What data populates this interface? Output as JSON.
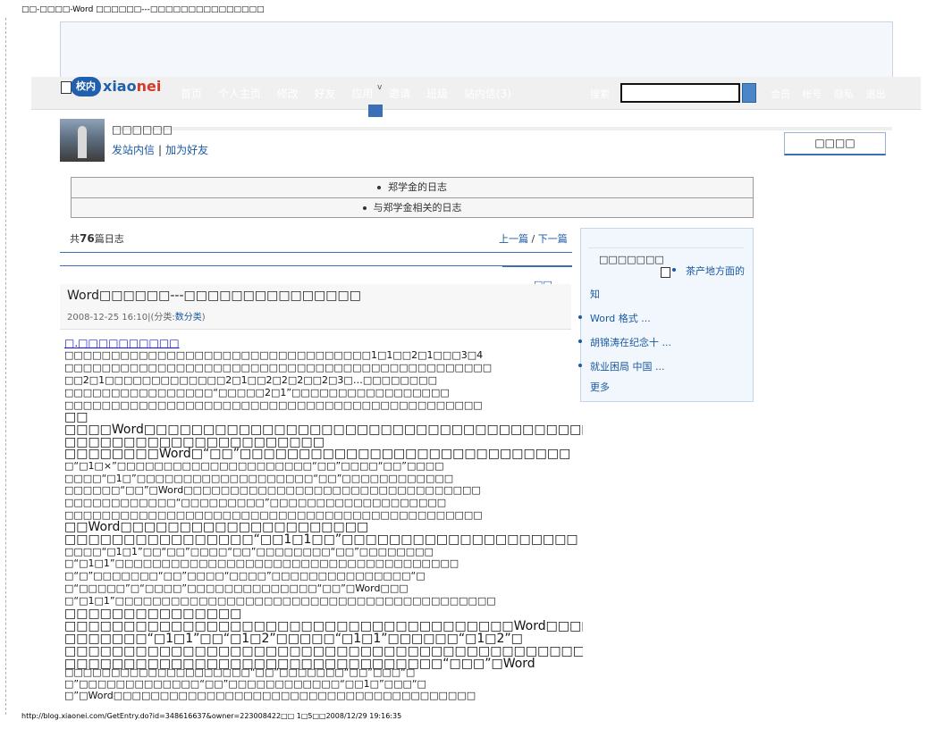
{
  "page_header": "□□-□□□□-Word □□□□□□---□□□□□□□□□□□□□□□",
  "page_footer": "http://blog.xiaonei.com/GetEntry.do?id=348616637&owner=223008422□□ 1□5□□2008/12/29 19:16:35",
  "logo": {
    "badge": "校内",
    "word_a": "xiao",
    "word_b": "nei",
    "square": "□"
  },
  "nav": {
    "items": [
      "首页",
      "个人主页",
      "修改",
      "好友",
      "应用",
      "邀请",
      "班级",
      "站内信(3)"
    ],
    "arrow": "v"
  },
  "search": {
    "label": "搜索",
    "value": ""
  },
  "user_links": [
    "会员",
    "帐号",
    "隐私",
    "退出"
  ],
  "profile": {
    "name": "□□□□□□",
    "send_msg": "发站内信",
    "add_friend": "加为好友",
    "separator": "|"
  },
  "right_tab": "□□□□",
  "tabs": [
    "郑学金的日志",
    "与郑学金相关的日志"
  ],
  "count": {
    "prefix": "共",
    "number": "76",
    "suffix": "篇日志"
  },
  "prevnext": {
    "prev": "上一篇",
    "sep": "/",
    "next": "下一篇"
  },
  "sidebar_link": "□□",
  "post": {
    "title": "Word□□□□□□---□□□□□□□□□□□□□□□",
    "datetime": "2008-12-25 16:10",
    "meta_sep": "|(",
    "category_label": "分类:",
    "category": "数分类",
    "meta_close": ")"
  },
  "body_lines": [
    {
      "text": "□.□□□□□□□□□□",
      "style": "link"
    },
    {
      "text": "□□□□□□□□□□□□□□□□□□□□□□□□□□□□□□□□□1□1□□2□1□□□3□4",
      "style": ""
    },
    {
      "text": "□□□□□□□□□□□□□□□□□□□□□□□□□□□□□□□□□□□□□□□□□□□□□□",
      "style": ""
    },
    {
      "text": "□□2□1□□□□□□□□□□□□□2□1□□2□2□2□□2□3□…□□□□□□□□",
      "style": ""
    },
    {
      "text": "□□□□□□□□□□□□□□□□“□□□□□2□1”□□□□□□□□□□□□□□□□□",
      "style": ""
    },
    {
      "text": "□□□□□□□□□□□□□□□□□□□□□□□□□□□□□□□□□□□□□□□□□□□□□",
      "style": ""
    },
    {
      "text": "□□",
      "style": "big"
    },
    {
      "text": "  □□□□Word□□□□□□□□□□□□□□□□□□□□□□□□□□□□□□□□□□□□□□",
      "style": "big"
    },
    {
      "text": "□□□□□□□□□□□□□□□□□□□□□□",
      "style": "big"
    },
    {
      "text": "  □□□□□□□□Word□“□□”□□□□□□□□□□□□□□□□□□□□□□□□□□□□",
      "style": "big"
    },
    {
      "text": "□“□1□×”□□□□□□□□□□□□□□□□□□□□□“□□”□□□□“□□”□□□□",
      "style": ""
    },
    {
      "text": "□□□□“□1□”□□□□□□□□□□□□□□□□□□□“□□”□□□□□□□□□□□□",
      "style": ""
    },
    {
      "text": "□□□□□□“□□”□Word□□□□□□□□□□□□□□□□□□□□□□□□□□□□□□□□",
      "style": ""
    },
    {
      "text": "□□□□□□□□□□□□“□□□□□□□□□”□□□□□□□□□□□□□□□□□□□",
      "style": ""
    },
    {
      "text": "□□□□□□□□□□□□□□□□□□□□□□□□□□□□□□□□□□□□□□□□□□□□□",
      "style": ""
    },
    {
      "text": "□□Word□□□□□□□□□□□□□□□□□□□□□",
      "style": "big"
    },
    {
      "text": "  □□□□□□□□□□□□□□□□“□□1□1□□”□□□□□□□□□□□□□□□□□□□□",
      "style": "big"
    },
    {
      "text": "□□□□“□1□1”□□“□□”□□□□“□□”□□□□□□□□“□□”□□□□□□□□",
      "style": ""
    },
    {
      "text": "□“□1□1”□□□□□□□□□□□□□□□□□□□□□□□□□□□□□□□□□□□□□",
      "style": ""
    },
    {
      "text": "□“□”□□□□□□□“□□”□□□□“□□□□”□□□□□□□□□□□□□□□“□",
      "style": ""
    },
    {
      "text": "□“□□□□□”□“□□□□”□□□□□□□□□□□□□□“□□”□Word□□□",
      "style": ""
    },
    {
      "text": "□“□1□1”□□□□□□□□□□□□□□□□□□□□□□□□□□□□□□□□□□□□□□□□□",
      "style": ""
    },
    {
      "text": "□□□□□□□□□□□□□□□",
      "style": "big"
    },
    {
      "text": "  □□□□□□□□□□□□□□□□□□□□□□□□□□□□□□□□□□□□□□Word□□□□",
      "style": "big"
    },
    {
      "text": "□□□□□□□“□1□1”□□“□1□2”□□□□□“□1□1”□□□□□□“□1□2”□",
      "style": "big"
    },
    {
      "text": "  □□□□□□□□□□□□□□□□□□□□□□□□□□□□□□□□□□□□□□□□□□□□",
      "style": "big"
    },
    {
      "text": "  □□□□□□□□□□□□□□□□□□□□□□□□□□□□□□□□“□□□”□Word",
      "style": "big"
    },
    {
      "text": "□□□□□□□□□□□□□□□□□□□□“□□”□□□□□□□“□□”□□□“□",
      "style": ""
    },
    {
      "text": "□”□□□□□□□□□□□□□“□□”□□□□□□□□□□□□“□□1□”□□□“□",
      "style": ""
    },
    {
      "text": "□”□Word□□□□□□□□□□□□□□□□□□□□□□□□□□□□□□□□□□□□□□□",
      "style": ""
    }
  ],
  "sidebar": {
    "title": "□□□□□□□",
    "items": [
      {
        "text": "茶产地方面的"
      },
      {
        "text": "知"
      },
      {
        "text": "Word 格式 ..."
      },
      {
        "text": "胡锦涛在纪念十 ..."
      },
      {
        "text": "就业困局 中国 ..."
      },
      {
        "text": "更多"
      }
    ]
  }
}
